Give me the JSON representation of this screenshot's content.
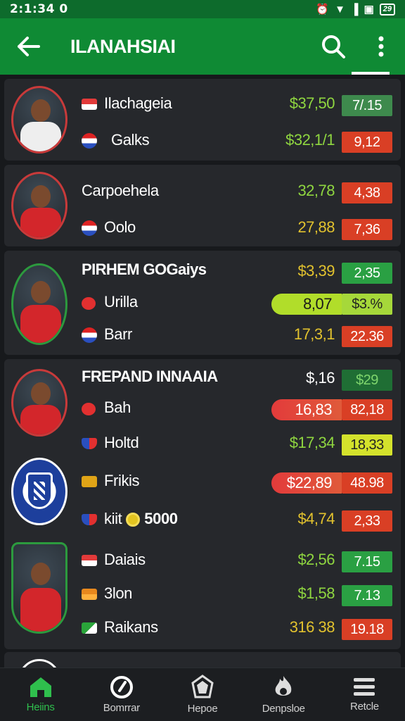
{
  "status": {
    "time": "2:1:34",
    "time_suffix": "0",
    "battery": "29"
  },
  "header": {
    "title": "ILANAHSIAI"
  },
  "cards": [
    {
      "rows": [
        {
          "label": "Ilachageia",
          "price": "$37,50",
          "price_color": "#8fd640",
          "badge": "7/.15",
          "badge_color": "b-dgreen"
        },
        {
          "label": "Galks",
          "price": "$32,1/1",
          "price_color": "#8fd640",
          "badge": "9,12",
          "badge_color": "b-red"
        }
      ]
    },
    {
      "rows": [
        {
          "label": "Carpoehela",
          "price": "32,78",
          "badge": "4,38"
        },
        {
          "label": "Oolo",
          "price": "27,88",
          "badge": "7,36"
        }
      ]
    },
    {
      "team": "PIRHEM GOGaiys",
      "rows": [
        {
          "label": "$3,39",
          "badge": "2,35"
        },
        {
          "label": "Urilla",
          "bar": "8,07",
          "badge": "$3.%"
        },
        {
          "label": "Barr",
          "price": "17,3,1",
          "badge": "22.36"
        }
      ]
    },
    {
      "team": "FREPAND INNAAIA",
      "rows": [
        {
          "price": "$,16",
          "badge": "$29"
        },
        {
          "label": "Bah",
          "bar": "16,83",
          "badge": "82,18"
        },
        {
          "label": "Holtd",
          "price": "$17,34",
          "badge": "18,33"
        },
        {
          "label": "Frikis",
          "bar": "$22,89",
          "badge": "48.98"
        },
        {
          "label": "kiit",
          "extra": "5000",
          "price": "$4,74",
          "badge": "2,33"
        },
        {
          "label": "Daiais",
          "price": "$2,56",
          "badge": "7.15"
        },
        {
          "label": "3lon",
          "price": "$1,58",
          "badge": "7.13"
        },
        {
          "label": "Raikans",
          "price": "316 38",
          "badge": "19.18"
        }
      ]
    }
  ],
  "nav": [
    {
      "label": "Heiins",
      "icon": "home-icon"
    },
    {
      "label": "Bomrrar",
      "icon": "compass-icon"
    },
    {
      "label": "Hepoe",
      "icon": "shield-icon"
    },
    {
      "label": "Denpsloe",
      "icon": "fire-icon"
    },
    {
      "label": "Retcle",
      "icon": "menu-icon"
    }
  ]
}
